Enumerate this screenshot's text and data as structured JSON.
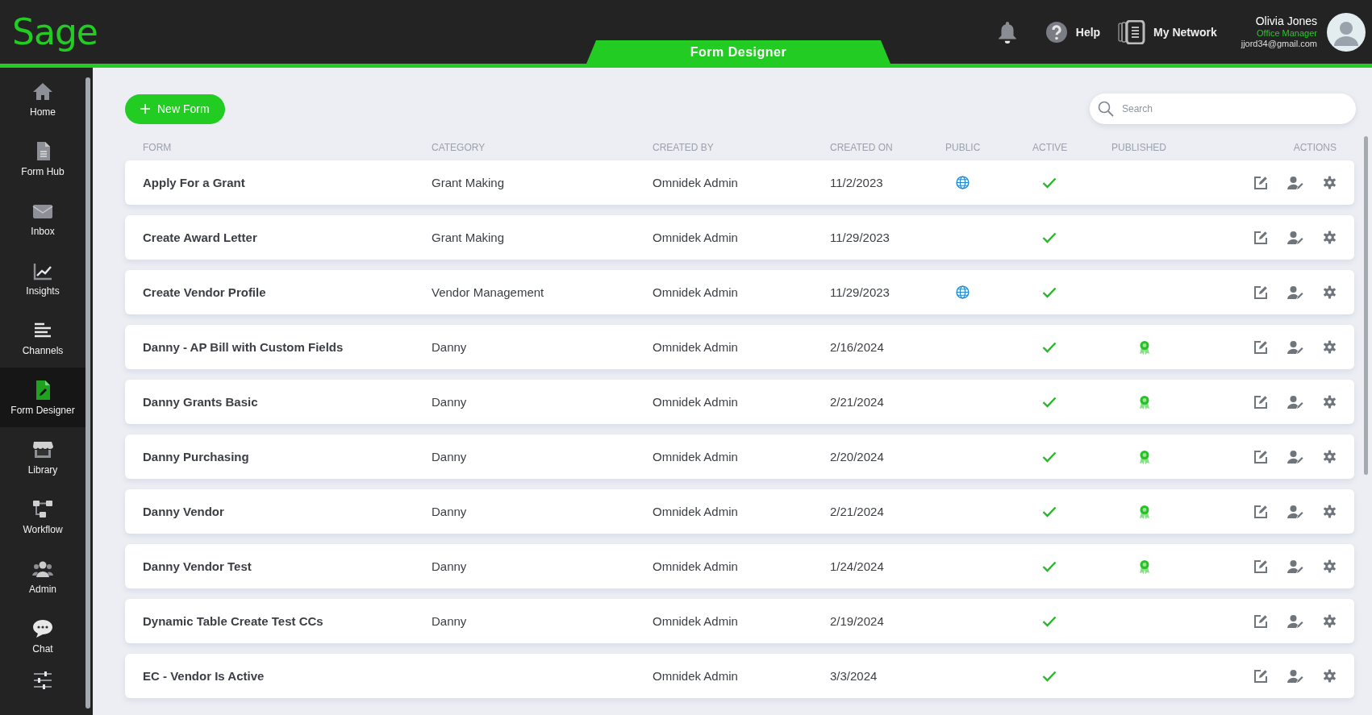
{
  "header": {
    "logo": "Sage",
    "tab": "Form Designer",
    "help": "Help",
    "network": "My Network",
    "user": {
      "name": "Olivia Jones",
      "role": "Office Manager",
      "email": "jjord34@gmail.com"
    }
  },
  "sidebar": {
    "items": [
      {
        "label": "Home",
        "kind": "home",
        "selected": false
      },
      {
        "label": "Form Hub",
        "kind": "doc",
        "selected": false
      },
      {
        "label": "Inbox",
        "kind": "mail",
        "selected": false
      },
      {
        "label": "Insights",
        "kind": "chart",
        "selected": false
      },
      {
        "label": "Channels",
        "kind": "lines",
        "selected": false
      },
      {
        "label": "Form Designer",
        "kind": "design",
        "selected": true
      },
      {
        "label": "Library",
        "kind": "store",
        "selected": false
      },
      {
        "label": "Workflow",
        "kind": "flow",
        "selected": false
      },
      {
        "label": "Admin",
        "kind": "users",
        "selected": false
      },
      {
        "label": "Chat",
        "kind": "chat",
        "selected": false
      },
      {
        "kind": "sliders",
        "selected": false
      }
    ]
  },
  "toolbar": {
    "new_button": "New Form",
    "search": {
      "placeholder": "Search"
    }
  },
  "table": {
    "columns": [
      "FORM",
      "CATEGORY",
      "CREATED BY",
      "CREATED ON",
      "PUBLIC",
      "ACTIVE",
      "PUBLISHED",
      "ACTIONS"
    ],
    "rows": [
      {
        "form": "Apply For a Grant",
        "category": "Grant Making",
        "created_by": "Omnidek Admin",
        "created_on": "11/2/2023",
        "public": true,
        "active": true,
        "published": false
      },
      {
        "form": "Create Award Letter",
        "category": "Grant Making",
        "created_by": "Omnidek Admin",
        "created_on": "11/29/2023",
        "public": false,
        "active": true,
        "published": false
      },
      {
        "form": "Create Vendor Profile",
        "category": "Vendor Management",
        "created_by": "Omnidek Admin",
        "created_on": "11/29/2023",
        "public": true,
        "active": true,
        "published": false
      },
      {
        "form": "Danny - AP Bill with Custom Fields",
        "category": "Danny",
        "created_by": "Omnidek Admin",
        "created_on": "2/16/2024",
        "public": false,
        "active": true,
        "published": true
      },
      {
        "form": "Danny Grants Basic",
        "category": "Danny",
        "created_by": "Omnidek Admin",
        "created_on": "2/21/2024",
        "public": false,
        "active": true,
        "published": true
      },
      {
        "form": "Danny Purchasing",
        "category": "Danny",
        "created_by": "Omnidek Admin",
        "created_on": "2/20/2024",
        "public": false,
        "active": true,
        "published": true
      },
      {
        "form": "Danny Vendor",
        "category": "Danny",
        "created_by": "Omnidek Admin",
        "created_on": "2/21/2024",
        "public": false,
        "active": true,
        "published": true
      },
      {
        "form": "Danny Vendor Test",
        "category": "Danny",
        "created_by": "Omnidek Admin",
        "created_on": "1/24/2024",
        "public": false,
        "active": true,
        "published": true
      },
      {
        "form": "Dynamic Table Create Test CCs",
        "category": "Danny",
        "created_by": "Omnidek Admin",
        "created_on": "2/19/2024",
        "public": false,
        "active": true,
        "published": false
      },
      {
        "form": "EC - Vendor Is Active",
        "created_by": "Omnidek Admin",
        "created_on": "3/3/2024",
        "public": false,
        "active": true,
        "published": false
      }
    ]
  }
}
